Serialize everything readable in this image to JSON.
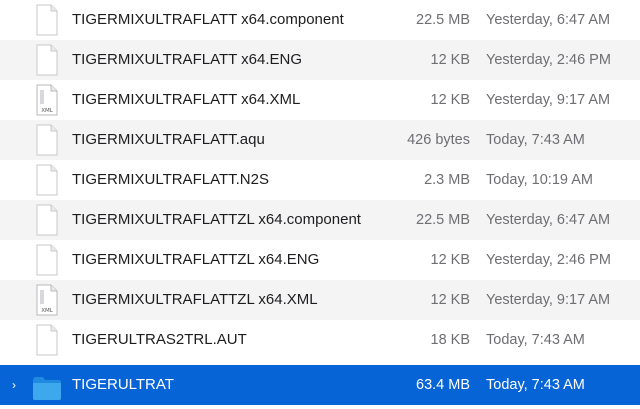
{
  "files": [
    {
      "name": "TIGERMIXULTRAFLATT x64.component",
      "size": "22.5 MB",
      "date": "Yesterday, 6:47 AM",
      "icon": "document-icon"
    },
    {
      "name": "TIGERMIXULTRAFLATT x64.ENG",
      "size": "12 KB",
      "date": "Yesterday, 2:46 PM",
      "icon": "document-icon"
    },
    {
      "name": "TIGERMIXULTRAFLATT x64.XML",
      "size": "12 KB",
      "date": "Yesterday, 9:17 AM",
      "icon": "xml-document-icon",
      "icon_label": "XML"
    },
    {
      "name": "TIGERMIXULTRAFLATT.aqu",
      "size": "426 bytes",
      "date": "Today, 7:43 AM",
      "icon": "document-icon"
    },
    {
      "name": "TIGERMIXULTRAFLATT.N2S",
      "size": "2.3 MB",
      "date": "Today, 10:19 AM",
      "icon": "document-icon"
    },
    {
      "name": "TIGERMIXULTRAFLATTZL x64.component",
      "size": "22.5 MB",
      "date": "Yesterday, 6:47 AM",
      "icon": "document-icon"
    },
    {
      "name": "TIGERMIXULTRAFLATTZL x64.ENG",
      "size": "12 KB",
      "date": "Yesterday, 2:46 PM",
      "icon": "document-icon"
    },
    {
      "name": "TIGERMIXULTRAFLATTZL x64.XML",
      "size": "12 KB",
      "date": "Yesterday, 9:17 AM",
      "icon": "xml-document-icon",
      "icon_label": "XML"
    },
    {
      "name": "TIGERULTRAS2TRL.AUT",
      "size": "18 KB",
      "date": "Today, 7:43 AM",
      "icon": "document-icon"
    },
    {
      "name": "TIGERULTRAT",
      "size": "63.4 MB",
      "date": "Today, 7:43 AM",
      "icon": "folder-icon",
      "selected": true,
      "disclosure": "›"
    }
  ],
  "colors": {
    "selection": "#0764d6",
    "stripe": "#f4f4f5",
    "text_primary": "#1d1d1f",
    "text_secondary": "#6e6e73",
    "folder": "#3ea8ee"
  }
}
